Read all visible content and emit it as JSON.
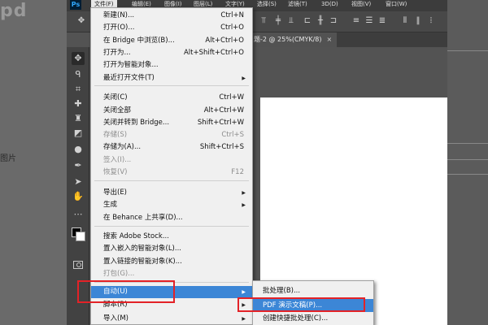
{
  "background": {
    "left_text": "pd",
    "side_label": "图片"
  },
  "app": {
    "logo": "Ps",
    "menu": [
      "文件(F)",
      "编辑(E)",
      "图像(I)",
      "图层(L)",
      "文字(Y)",
      "选择(S)",
      "滤镜(T)",
      "3D(D)",
      "视图(V)",
      "窗口(W)"
    ],
    "active_menu_index": 0,
    "document_tab": "题-2 @ 25%(CMYK/8)",
    "tab_close": "×"
  },
  "file_menu": {
    "items": [
      {
        "label": "新建(N)...",
        "shortcut": "Ctrl+N"
      },
      {
        "label": "打开(O)...",
        "shortcut": "Ctrl+O"
      },
      {
        "label": "在 Bridge 中浏览(B)...",
        "shortcut": "Alt+Ctrl+O"
      },
      {
        "label": "打开为...",
        "shortcut": "Alt+Shift+Ctrl+O"
      },
      {
        "label": "打开为智能对象...",
        "shortcut": ""
      },
      {
        "label": "最近打开文件(T)",
        "shortcut": "",
        "submenu": true
      },
      {
        "label": "关闭(C)",
        "shortcut": "Ctrl+W"
      },
      {
        "label": "关闭全部",
        "shortcut": "Alt+Ctrl+W"
      },
      {
        "label": "关闭并转到 Bridge...",
        "shortcut": "Shift+Ctrl+W"
      },
      {
        "label": "存储(S)",
        "shortcut": "Ctrl+S",
        "disabled": true
      },
      {
        "label": "存储为(A)...",
        "shortcut": "Shift+Ctrl+S"
      },
      {
        "label": "签入(I)...",
        "shortcut": "",
        "disabled": true
      },
      {
        "label": "恢复(V)",
        "shortcut": "F12",
        "disabled": true
      },
      {
        "label": "导出(E)",
        "shortcut": "",
        "submenu": true
      },
      {
        "label": "生成",
        "shortcut": "",
        "submenu": true
      },
      {
        "label": "在 Behance 上共享(D)...",
        "shortcut": ""
      },
      {
        "label": "搜索 Adobe Stock...",
        "shortcut": ""
      },
      {
        "label": "置入嵌入的智能对象(L)...",
        "shortcut": ""
      },
      {
        "label": "置入链接的智能对象(K)...",
        "shortcut": ""
      },
      {
        "label": "打包(G)...",
        "shortcut": "",
        "disabled": true
      },
      {
        "label": "自动(U)",
        "shortcut": "",
        "submenu": true,
        "highlighted": true
      },
      {
        "label": "脚本(R)",
        "shortcut": "",
        "submenu": true
      },
      {
        "label": "导入(M)",
        "shortcut": "",
        "submenu": true
      }
    ]
  },
  "automate_submenu": {
    "items": [
      {
        "label": "批处理(B)..."
      },
      {
        "label": "PDF 演示文稿(P)...",
        "highlighted": true
      },
      {
        "label": "创建快捷批处理(C)..."
      }
    ]
  },
  "colors": {
    "highlight": "#3c86d6",
    "annotation": "#e32227",
    "ps_logo_bg": "#001d34",
    "ps_logo_fg": "#31a8ff"
  }
}
